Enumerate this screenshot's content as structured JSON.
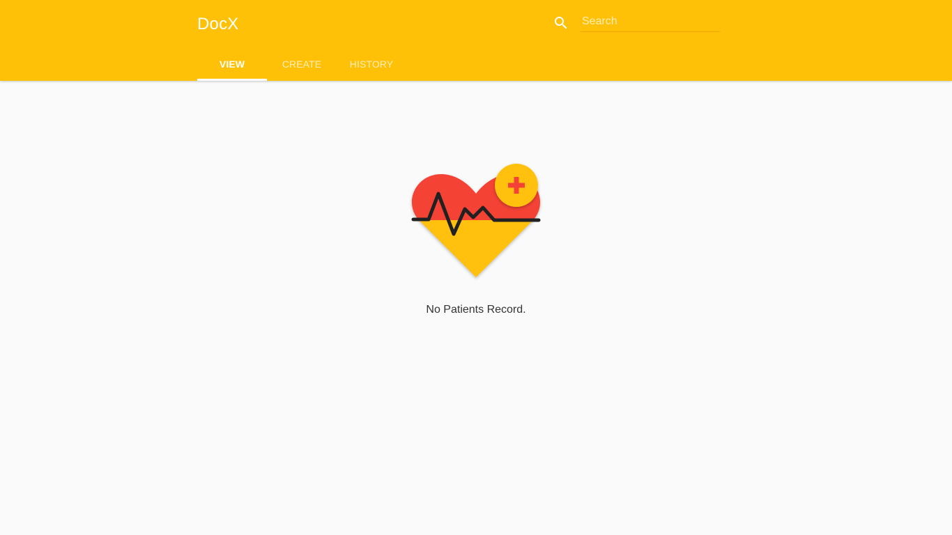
{
  "app": {
    "title": "DocX"
  },
  "search": {
    "icon": "search-icon",
    "placeholder": "Search",
    "value": ""
  },
  "tabs": [
    {
      "label": "VIEW",
      "active": true
    },
    {
      "label": "CREATE",
      "active": false
    },
    {
      "label": "HISTORY",
      "active": false
    }
  ],
  "empty_state": {
    "icon": "heart-pulse-plus-icon",
    "message": "No Patients Record."
  },
  "colors": {
    "primary": "#ffc107",
    "heart_red": "#f44336",
    "heart_yellow": "#ffc107",
    "background": "#fafafa"
  }
}
